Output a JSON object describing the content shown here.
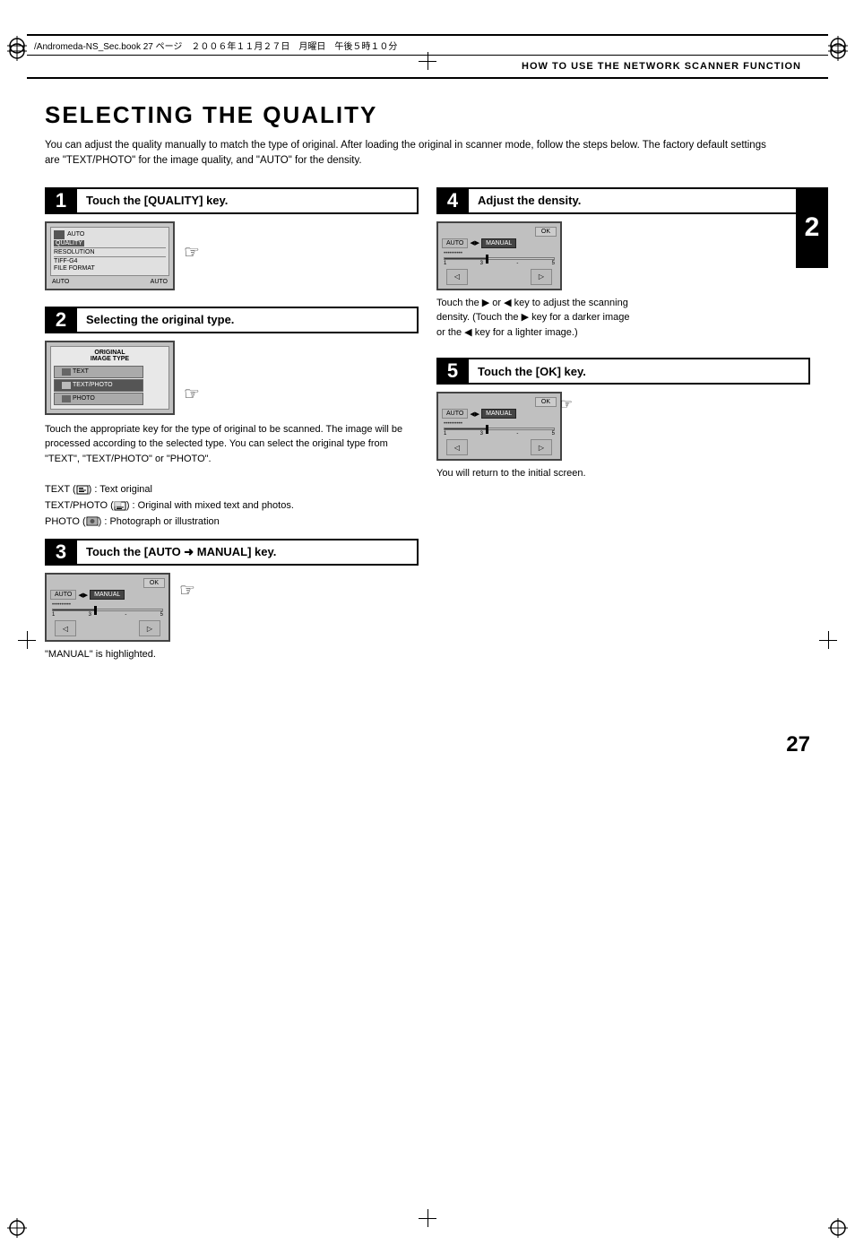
{
  "page": {
    "number": "27",
    "section_header": "HOW TO USE THE NETWORK SCANNER FUNCTION",
    "title": "SELECTING THE QUALITY",
    "intro": "You can adjust the quality manually to match the type of original. After loading the original in scanner mode, follow the steps below. The factory default settings are \"TEXT/PHOTO\" for the image quality, and \"AUTO\" for the density.",
    "top_bar_text": "/Andromeda-NS_Sec.book  27 ページ　２００６年１１月２７日　月曜日　午後５時１０分"
  },
  "steps": {
    "step1": {
      "number": "1",
      "title": "Touch the [QUALITY] key.",
      "ui_labels": {
        "auto": "AUTO",
        "quality": "QUALITY",
        "resolution": "RESOLUTION",
        "tiff": "TIFF-G4",
        "file_format": "FILE FORMAT"
      }
    },
    "step2": {
      "number": "2",
      "title": "Selecting the original type.",
      "description": "Touch the appropriate key for the type of original to be scanned. The image will be processed according to the selected type. You can select the original type from \"TEXT\", \"TEXT/PHOTO\" or \"PHOTO\".",
      "ui_labels": {
        "original": "ORIGINAL",
        "image_type": "IMAGE TYPE",
        "text": "TEXT",
        "text_photo": "TEXT/PHOTO",
        "photo": "PHOTO"
      }
    },
    "step3": {
      "number": "3",
      "title": "Touch the [AUTO ➜ MANUAL] key.",
      "description": "\"MANUAL\" is highlighted.",
      "ui_labels": {
        "ok": "OK",
        "auto": "AUTO",
        "manual": "MANUAL"
      }
    },
    "step4": {
      "number": "4",
      "title": "Adjust the density.",
      "description": "Touch the ▶ or ◀ key to adjust the scanning density. (Touch the ▶ key for a darker image or the ◀ key for a lighter image.)",
      "ui_labels": {
        "ok": "OK",
        "auto": "AUTO",
        "manual": "MANUAL"
      }
    },
    "step5": {
      "number": "5",
      "title": "Touch the [OK] key.",
      "description": "You will return to the initial screen.",
      "ui_labels": {
        "ok": "OK",
        "auto": "AUTO",
        "manual": "MANUAL"
      }
    }
  },
  "notes": {
    "line1": "TEXT (  ) : Text original",
    "line2": "TEXT/PHOTO (  ) : Original with mixed text and photos.",
    "line3": "PHOTO (  ) : Photograph or illustration"
  },
  "section_badge": "2"
}
